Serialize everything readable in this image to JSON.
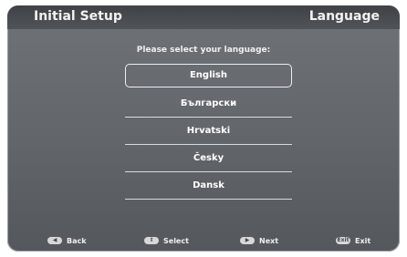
{
  "header": {
    "title": "Initial Setup",
    "section": "Language"
  },
  "prompt": "Please select your language:",
  "languages": [
    {
      "label": "English",
      "selected": true
    },
    {
      "label": "Български",
      "selected": false
    },
    {
      "label": "Hrvatski",
      "selected": false
    },
    {
      "label": "Česky",
      "selected": false
    },
    {
      "label": "Dansk",
      "selected": false
    }
  ],
  "footer": {
    "back": {
      "key": "◀",
      "label": "Back"
    },
    "select": {
      "key": "⇕",
      "label": "Select"
    },
    "next": {
      "key": "▶",
      "label": "Next"
    },
    "exit": {
      "key": "Exit",
      "label": "Exit"
    }
  }
}
